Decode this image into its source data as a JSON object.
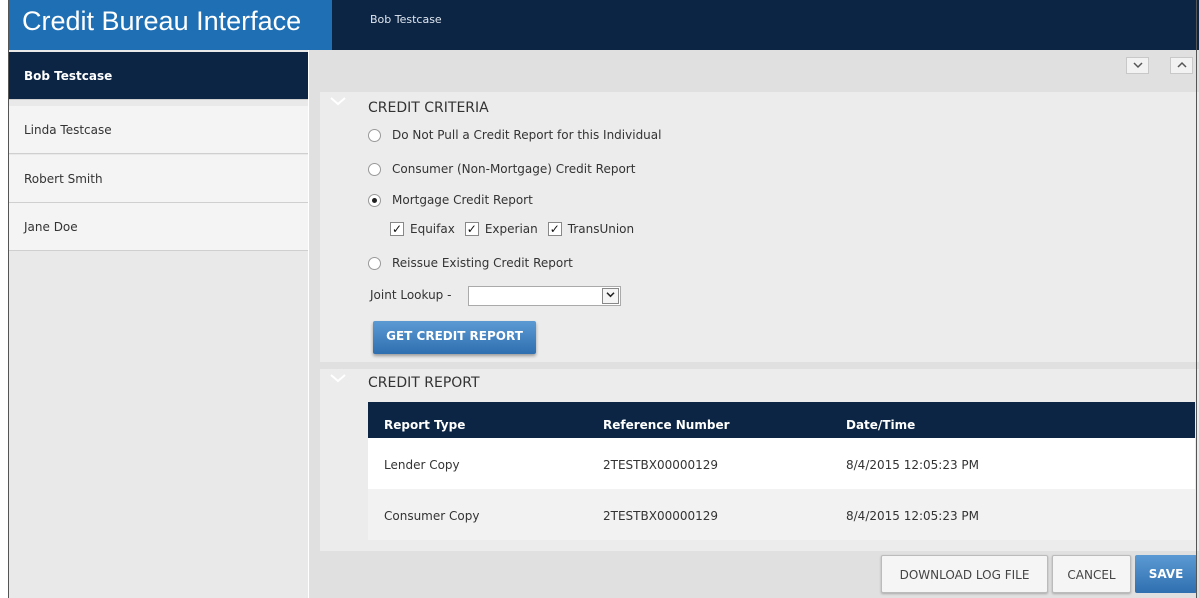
{
  "app": {
    "title": "Credit Bureau Interface"
  },
  "header": {
    "user": "Bob Testcase"
  },
  "sidebar": {
    "items": [
      {
        "label": "Bob Testcase",
        "active": true
      },
      {
        "label": "Linda Testcase",
        "active": false
      },
      {
        "label": "Robert Smith",
        "active": false
      },
      {
        "label": "Jane Doe",
        "active": false
      }
    ]
  },
  "toggles": {
    "expand_icon": "chevron-down-icon",
    "collapse_icon": "chevron-up-icon"
  },
  "credit_criteria": {
    "title": "CREDIT CRITERIA",
    "options": [
      {
        "label": "Do Not Pull a Credit Report for this Individual",
        "selected": false
      },
      {
        "label": "Consumer (Non-Mortgage) Credit Report",
        "selected": false
      },
      {
        "label": "Mortgage Credit Report",
        "selected": true
      },
      {
        "label": "Reissue Existing Credit Report",
        "selected": false
      }
    ],
    "bureaus": [
      {
        "label": "Equifax",
        "checked": true
      },
      {
        "label": "Experian",
        "checked": true
      },
      {
        "label": "TransUnion",
        "checked": true
      }
    ],
    "joint_lookup_label": "Joint Lookup -",
    "joint_lookup_value": "",
    "get_button": "GET CREDIT REPORT"
  },
  "credit_report": {
    "title": "CREDIT REPORT",
    "columns": [
      "Report Type",
      "Reference Number",
      "Date/Time"
    ],
    "rows": [
      [
        "Lender Copy",
        "2TESTBX00000129",
        "8/4/2015 12:05:23 PM"
      ],
      [
        "Consumer Copy",
        "2TESTBX00000129",
        "8/4/2015 12:05:23 PM"
      ]
    ]
  },
  "actions": {
    "download": "DOWNLOAD LOG FILE",
    "cancel": "CANCEL",
    "save": "SAVE"
  },
  "colors": {
    "brand_blue": "#1f6fb5",
    "navy": "#0c2545",
    "button_blue": "#3d80c2"
  }
}
